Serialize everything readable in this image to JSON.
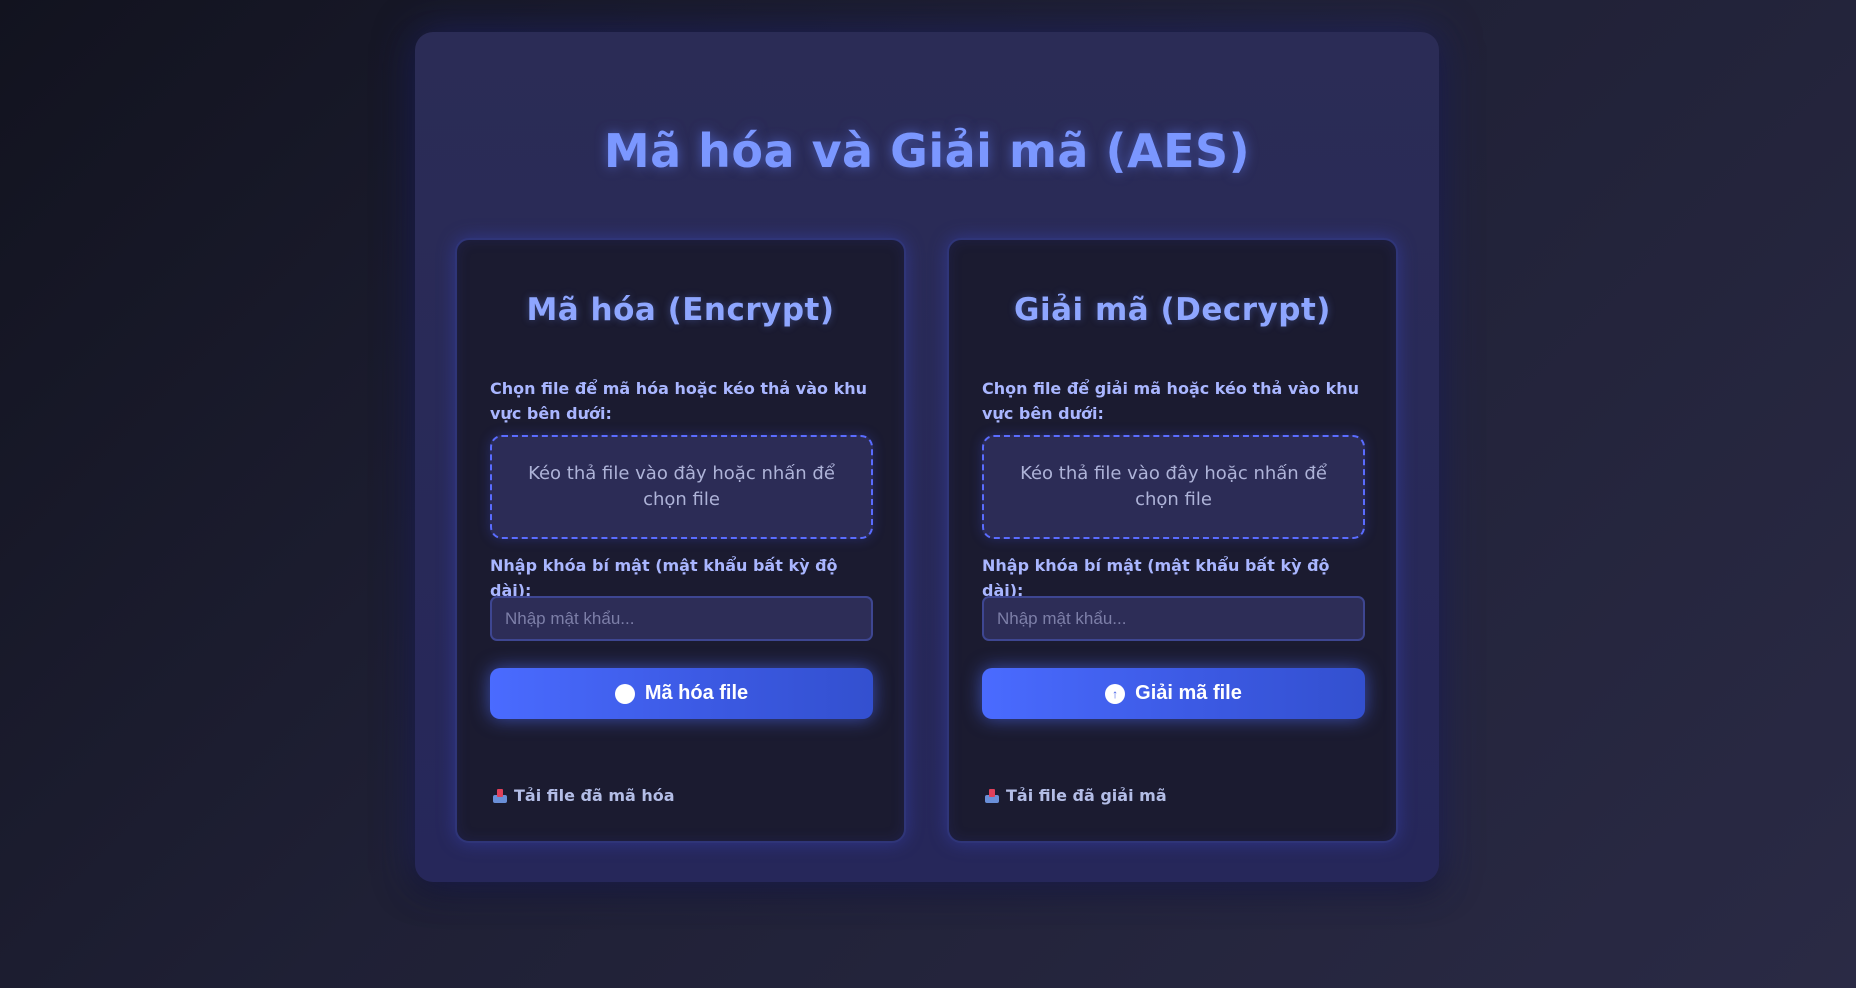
{
  "title": "Mã hóa và Giải mã (AES)",
  "encrypt": {
    "heading": "Mã hóa (Encrypt)",
    "file_label": "Chọn file để mã hóa hoặc kéo thả vào khu vực bên dưới:",
    "dropzone_text": "Kéo thả file vào đây hoặc nhấn để chọn file",
    "key_label": "Nhập khóa bí mật (mật khẩu bất kỳ độ dài):",
    "password_placeholder": "Nhập mật khẩu...",
    "button_label": "Mã hóa file",
    "button_icon": "circle-icon",
    "download_label": "Tải file đã mã hóa",
    "download_icon": "inbox-tray-icon"
  },
  "decrypt": {
    "heading": "Giải mã (Decrypt)",
    "file_label": "Chọn file để giải mã hoặc kéo thả vào khu vực bên dưới:",
    "dropzone_text": "Kéo thả file vào đây hoặc nhấn để chọn file",
    "key_label": "Nhập khóa bí mật (mật khẩu bất kỳ độ dài):",
    "password_placeholder": "Nhập mật khẩu...",
    "button_label": "Giải mã file",
    "button_icon": "unlock-circle-icon",
    "download_label": "Tải file đã giải mã",
    "download_icon": "inbox-tray-icon"
  },
  "colors": {
    "accent": "#4a6bff",
    "title": "#7b97ff",
    "background": "#1f2035",
    "panel": "#1b1b30"
  }
}
